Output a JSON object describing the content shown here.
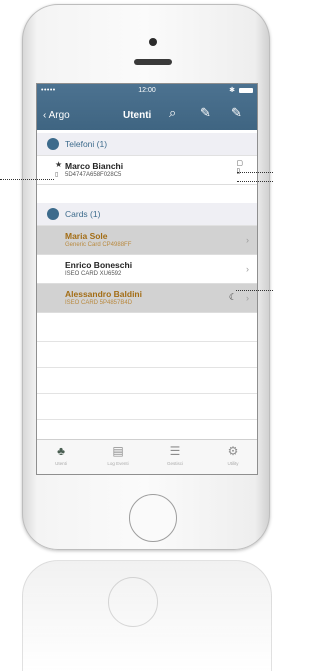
{
  "status_bar": {
    "signal": "•••••",
    "time": "12:00",
    "bluetooth": "✱"
  },
  "nav": {
    "back_label": "Argo",
    "title": "Utenti",
    "icons": [
      "search-icon",
      "edit-key-icon",
      "edit-key-icon"
    ]
  },
  "sections": [
    {
      "label": "Telefoni (1)"
    },
    {
      "label": "Cards (1)"
    }
  ],
  "phones": [
    {
      "name": "Marco Bianchi",
      "id": "5D4747A658F028C5",
      "starred": true
    }
  ],
  "cards": [
    {
      "name": "Maria Sole",
      "detail": "Generic Card CP4988FF",
      "state": "disabled"
    },
    {
      "name": "Enrico Boneschi",
      "detail": "ISEO CARD XU6592",
      "state": "active"
    },
    {
      "name": "Alessandro Baldini",
      "detail": "ISEO CARD 5P4857B4D",
      "state": "disabled"
    }
  ],
  "tabbar": {
    "items": [
      {
        "label": "Utenti",
        "icon": "users-icon"
      },
      {
        "label": "Log Eventi",
        "icon": "log-icon"
      },
      {
        "label": "Gestisci",
        "icon": "list-icon"
      },
      {
        "label": "Utility",
        "icon": "gear-icon"
      }
    ]
  }
}
